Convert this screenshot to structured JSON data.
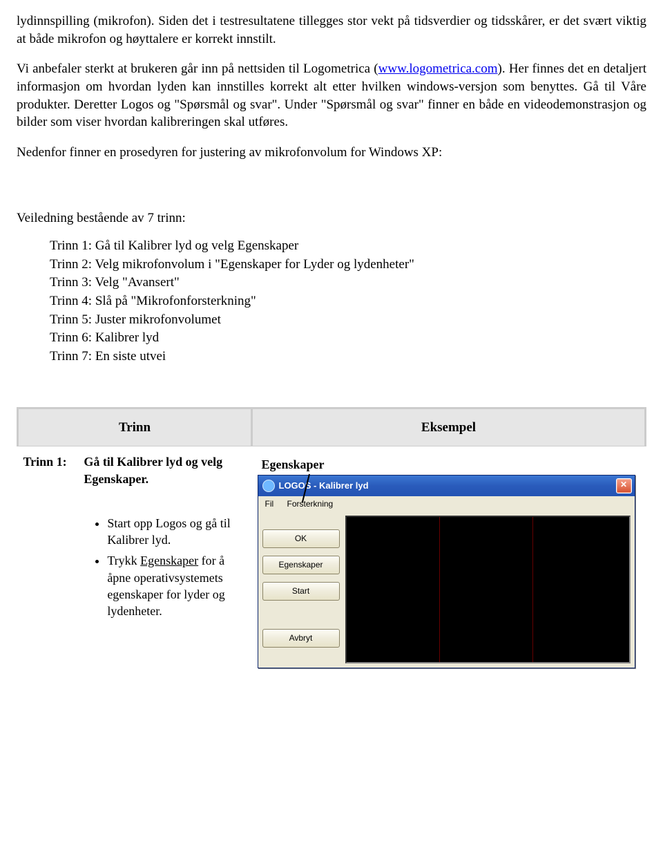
{
  "paragraphs": {
    "p1": "lydinnspilling (mikrofon). Siden det i testresultatene tillegges stor vekt på tidsverdier og tidsskårer, er det svært viktig at både mikrofon og høyttalere er korrekt innstilt.",
    "p2a": "Vi anbefaler sterkt at brukeren går inn på nettsiden til Logometrica (",
    "p2_link": "www.logometrica.com",
    "p2b": "). Her finnes det en detaljert informasjon om hvordan lyden kan innstilles korrekt alt etter hvilken windows-versjon som benyttes. Gå til Våre produkter. Deretter Logos og \"Spørsmål og svar\". Under \"Spørsmål og svar\" finner en både en videodemonstrasjon og bilder som viser hvordan kalibreringen skal utføres.",
    "p3": "Nedenfor finner en prosedyren for justering av mikrofonvolum for Windows XP:",
    "intro": "Veiledning bestående av 7 trinn:"
  },
  "steps": [
    "Trinn 1: Gå til Kalibrer lyd og velg Egenskaper",
    "Trinn 2: Velg mikrofonvolum i \"Egenskaper for Lyder og lydenheter\"",
    "Trinn 3: Velg \"Avansert\"",
    "Trinn 4: Slå på \"Mikrofonforsterkning\"",
    "Trinn 5: Juster mikrofonvolumet",
    "Trinn 6: Kalibrer lyd",
    "Trinn 7: En siste utvei"
  ],
  "table": {
    "col1": "Trinn",
    "col2": "Eksempel",
    "row1": {
      "num": "Trinn 1:",
      "title": "Gå til Kalibrer lyd og velg Egenskaper.",
      "bullets": {
        "b1": "Start opp Logos og gå til Kalibrer lyd.",
        "b2a": "Trykk ",
        "b2u": "Egenskaper",
        "b2b": " for å åpne operativsystemets egenskaper for lyder og lydenheter."
      }
    }
  },
  "screenshot": {
    "pointer_label": "Egenskaper",
    "window_title": "LOGOS - Kalibrer lyd",
    "menu_fil": "Fil",
    "menu_forsterkning": "Forsterkning",
    "buttons": {
      "ok": "OK",
      "egenskaper": "Egenskaper",
      "start": "Start",
      "avbryt": "Avbryt"
    },
    "close_glyph": "✕"
  }
}
